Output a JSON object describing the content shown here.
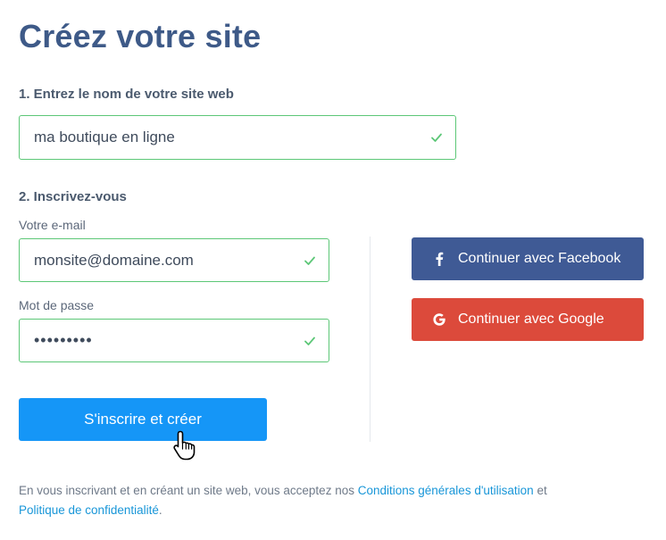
{
  "title": "Créez votre site",
  "step1": {
    "label": "1. Entrez le nom de votre site web",
    "site_name_value": "ma boutique en ligne"
  },
  "step2": {
    "label": "2. Inscrivez-vous",
    "email_label": "Votre e-mail",
    "email_value": "monsite@domaine.com",
    "password_label": "Mot de passe",
    "password_value": "•••••••••"
  },
  "buttons": {
    "submit": "S'inscrire et créer",
    "facebook": "Continuer avec Facebook",
    "google": "Continuer avec Google"
  },
  "legal": {
    "prefix": "En vous inscrivant et en créant un site web, vous acceptez nos",
    "terms_link": "Conditions générales d'utilisation",
    "middle": "et",
    "privacy_link": "Politique de confidentialité",
    "suffix": "."
  },
  "colors": {
    "title": "#3e5a88",
    "valid_border": "#5cc777",
    "primary": "#1596f7",
    "facebook": "#3f5a95",
    "google": "#dc4a3b",
    "link": "#1896d8"
  },
  "icons": {
    "valid": "check-icon",
    "facebook": "facebook-icon",
    "google": "google-icon",
    "cursor": "hand-pointer-cursor"
  }
}
